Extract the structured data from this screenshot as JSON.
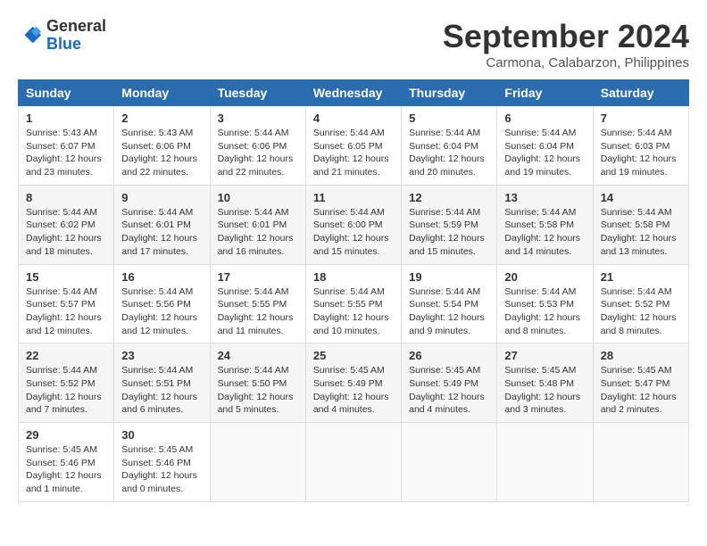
{
  "header": {
    "logo": {
      "line1": "General",
      "line2": "Blue"
    },
    "title": "September 2024",
    "location": "Carmona, Calabarzon, Philippines"
  },
  "calendar": {
    "headers": [
      "Sunday",
      "Monday",
      "Tuesday",
      "Wednesday",
      "Thursday",
      "Friday",
      "Saturday"
    ],
    "weeks": [
      [
        {
          "day": "1",
          "sunrise": "5:43 AM",
          "sunset": "6:07 PM",
          "daylight": "12 hours and 23 minutes."
        },
        {
          "day": "2",
          "sunrise": "5:43 AM",
          "sunset": "6:06 PM",
          "daylight": "12 hours and 22 minutes."
        },
        {
          "day": "3",
          "sunrise": "5:44 AM",
          "sunset": "6:06 PM",
          "daylight": "12 hours and 22 minutes."
        },
        {
          "day": "4",
          "sunrise": "5:44 AM",
          "sunset": "6:05 PM",
          "daylight": "12 hours and 21 minutes."
        },
        {
          "day": "5",
          "sunrise": "5:44 AM",
          "sunset": "6:04 PM",
          "daylight": "12 hours and 20 minutes."
        },
        {
          "day": "6",
          "sunrise": "5:44 AM",
          "sunset": "6:04 PM",
          "daylight": "12 hours and 19 minutes."
        },
        {
          "day": "7",
          "sunrise": "5:44 AM",
          "sunset": "6:03 PM",
          "daylight": "12 hours and 19 minutes."
        }
      ],
      [
        {
          "day": "8",
          "sunrise": "5:44 AM",
          "sunset": "6:02 PM",
          "daylight": "12 hours and 18 minutes."
        },
        {
          "day": "9",
          "sunrise": "5:44 AM",
          "sunset": "6:01 PM",
          "daylight": "12 hours and 17 minutes."
        },
        {
          "day": "10",
          "sunrise": "5:44 AM",
          "sunset": "6:01 PM",
          "daylight": "12 hours and 16 minutes."
        },
        {
          "day": "11",
          "sunrise": "5:44 AM",
          "sunset": "6:00 PM",
          "daylight": "12 hours and 15 minutes."
        },
        {
          "day": "12",
          "sunrise": "5:44 AM",
          "sunset": "5:59 PM",
          "daylight": "12 hours and 15 minutes."
        },
        {
          "day": "13",
          "sunrise": "5:44 AM",
          "sunset": "5:58 PM",
          "daylight": "12 hours and 14 minutes."
        },
        {
          "day": "14",
          "sunrise": "5:44 AM",
          "sunset": "5:58 PM",
          "daylight": "12 hours and 13 minutes."
        }
      ],
      [
        {
          "day": "15",
          "sunrise": "5:44 AM",
          "sunset": "5:57 PM",
          "daylight": "12 hours and 12 minutes."
        },
        {
          "day": "16",
          "sunrise": "5:44 AM",
          "sunset": "5:56 PM",
          "daylight": "12 hours and 12 minutes."
        },
        {
          "day": "17",
          "sunrise": "5:44 AM",
          "sunset": "5:55 PM",
          "daylight": "12 hours and 11 minutes."
        },
        {
          "day": "18",
          "sunrise": "5:44 AM",
          "sunset": "5:55 PM",
          "daylight": "12 hours and 10 minutes."
        },
        {
          "day": "19",
          "sunrise": "5:44 AM",
          "sunset": "5:54 PM",
          "daylight": "12 hours and 9 minutes."
        },
        {
          "day": "20",
          "sunrise": "5:44 AM",
          "sunset": "5:53 PM",
          "daylight": "12 hours and 8 minutes."
        },
        {
          "day": "21",
          "sunrise": "5:44 AM",
          "sunset": "5:52 PM",
          "daylight": "12 hours and 8 minutes."
        }
      ],
      [
        {
          "day": "22",
          "sunrise": "5:44 AM",
          "sunset": "5:52 PM",
          "daylight": "12 hours and 7 minutes."
        },
        {
          "day": "23",
          "sunrise": "5:44 AM",
          "sunset": "5:51 PM",
          "daylight": "12 hours and 6 minutes."
        },
        {
          "day": "24",
          "sunrise": "5:44 AM",
          "sunset": "5:50 PM",
          "daylight": "12 hours and 5 minutes."
        },
        {
          "day": "25",
          "sunrise": "5:45 AM",
          "sunset": "5:49 PM",
          "daylight": "12 hours and 4 minutes."
        },
        {
          "day": "26",
          "sunrise": "5:45 AM",
          "sunset": "5:49 PM",
          "daylight": "12 hours and 4 minutes."
        },
        {
          "day": "27",
          "sunrise": "5:45 AM",
          "sunset": "5:48 PM",
          "daylight": "12 hours and 3 minutes."
        },
        {
          "day": "28",
          "sunrise": "5:45 AM",
          "sunset": "5:47 PM",
          "daylight": "12 hours and 2 minutes."
        }
      ],
      [
        {
          "day": "29",
          "sunrise": "5:45 AM",
          "sunset": "5:46 PM",
          "daylight": "12 hours and 1 minute."
        },
        {
          "day": "30",
          "sunrise": "5:45 AM",
          "sunset": "5:46 PM",
          "daylight": "12 hours and 0 minutes."
        },
        null,
        null,
        null,
        null,
        null
      ]
    ]
  }
}
